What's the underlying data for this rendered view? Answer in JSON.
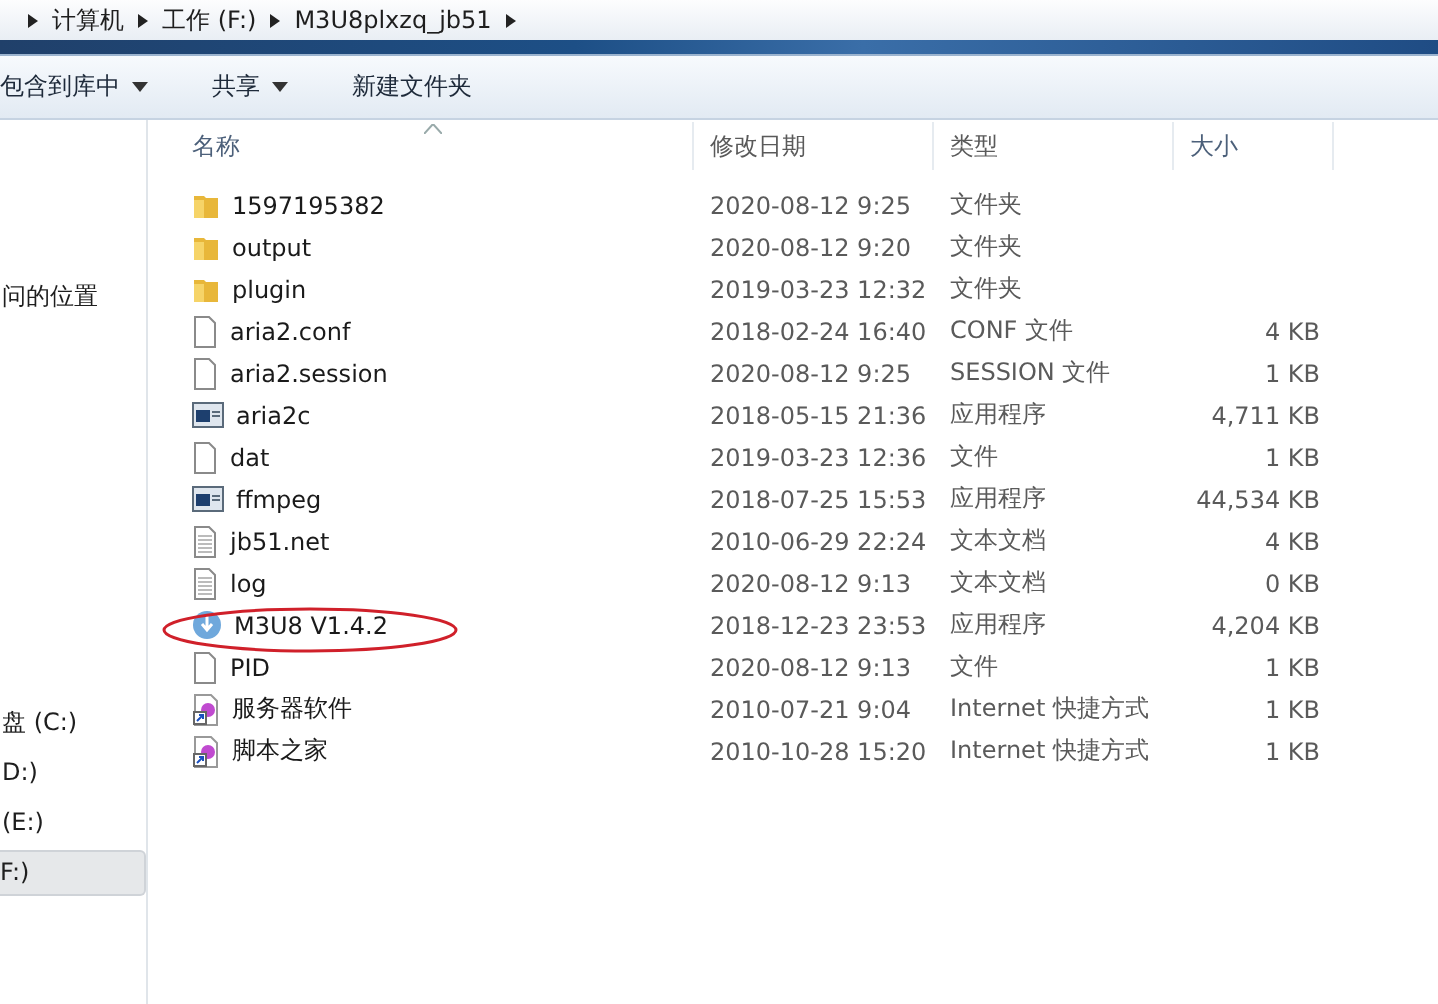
{
  "address_bar": {
    "crumbs": [
      "计算机",
      "工作 (F:)",
      "M3U8plxzq_jb51"
    ]
  },
  "toolbar": {
    "buttons": [
      {
        "label": "包含到库中",
        "dropdown": true
      },
      {
        "label": "共享",
        "dropdown": true
      },
      {
        "label": "新建文件夹",
        "dropdown": false
      }
    ]
  },
  "sidebar": {
    "favorites": [
      {
        "label": "问的位置",
        "selected": false
      }
    ],
    "drives": [
      {
        "label": "盘 (C:)",
        "selected": false
      },
      {
        "label": "D:)",
        "selected": false
      },
      {
        "label": "(E:)",
        "selected": false
      },
      {
        "label": "F:)",
        "selected": true
      }
    ]
  },
  "table": {
    "columns": [
      "名称",
      "修改日期",
      "类型",
      "大小"
    ],
    "rows": [
      {
        "kind": "folder",
        "name": "1597195382",
        "date": "2020-08-12 9:25",
        "type": "文件夹",
        "circled": false
      },
      {
        "kind": "folder",
        "name": "output",
        "date": "2020-08-12 9:20",
        "type": "文件夹",
        "circled": false
      },
      {
        "kind": "folder",
        "name": "plugin",
        "date": "2019-03-23 12:32",
        "type": "文件夹",
        "circled": false
      },
      {
        "kind": "file",
        "name": "aria2.conf",
        "date": "2018-02-24 16:40",
        "type": "CONF 文件",
        "size": "4 KB",
        "circled": false
      },
      {
        "kind": "file",
        "name": "aria2.session",
        "date": "2020-08-12 9:25",
        "type": "SESSION 文件",
        "size": "1 KB",
        "circled": false
      },
      {
        "kind": "exe",
        "name": "aria2c",
        "date": "2018-05-15 21:36",
        "type": "应用程序",
        "size": "4,711 KB",
        "circled": false
      },
      {
        "kind": "file",
        "name": "dat",
        "date": "2019-03-23 12:36",
        "type": "文件",
        "size": "1 KB",
        "circled": false
      },
      {
        "kind": "exe",
        "name": "ffmpeg",
        "date": "2018-07-25 15:53",
        "type": "应用程序",
        "size": "44,534 KB",
        "circled": false
      },
      {
        "kind": "text",
        "name": "jb51.net",
        "date": "2010-06-29 22:24",
        "type": "文本文档",
        "size": "4 KB",
        "circled": false
      },
      {
        "kind": "text",
        "name": "log",
        "date": "2020-08-12 9:13",
        "type": "文本文档",
        "size": "0 KB",
        "circled": false
      },
      {
        "kind": "app",
        "name": "M3U8 V1.4.2",
        "date": "2018-12-23 23:53",
        "type": "应用程序",
        "size": "4,204 KB",
        "circled": true
      },
      {
        "kind": "file",
        "name": "PID",
        "date": "2020-08-12 9:13",
        "type": "文件",
        "size": "1 KB",
        "circled": false
      },
      {
        "kind": "shortcut",
        "name": "服务器软件",
        "date": "2010-07-21 9:04",
        "type": "Internet 快捷方式",
        "size": "1 KB",
        "circled": false
      },
      {
        "kind": "shortcut",
        "name": "脚本之家",
        "date": "2010-10-28 15:20",
        "type": "Internet 快捷方式",
        "size": "1 KB",
        "circled": false
      }
    ]
  }
}
